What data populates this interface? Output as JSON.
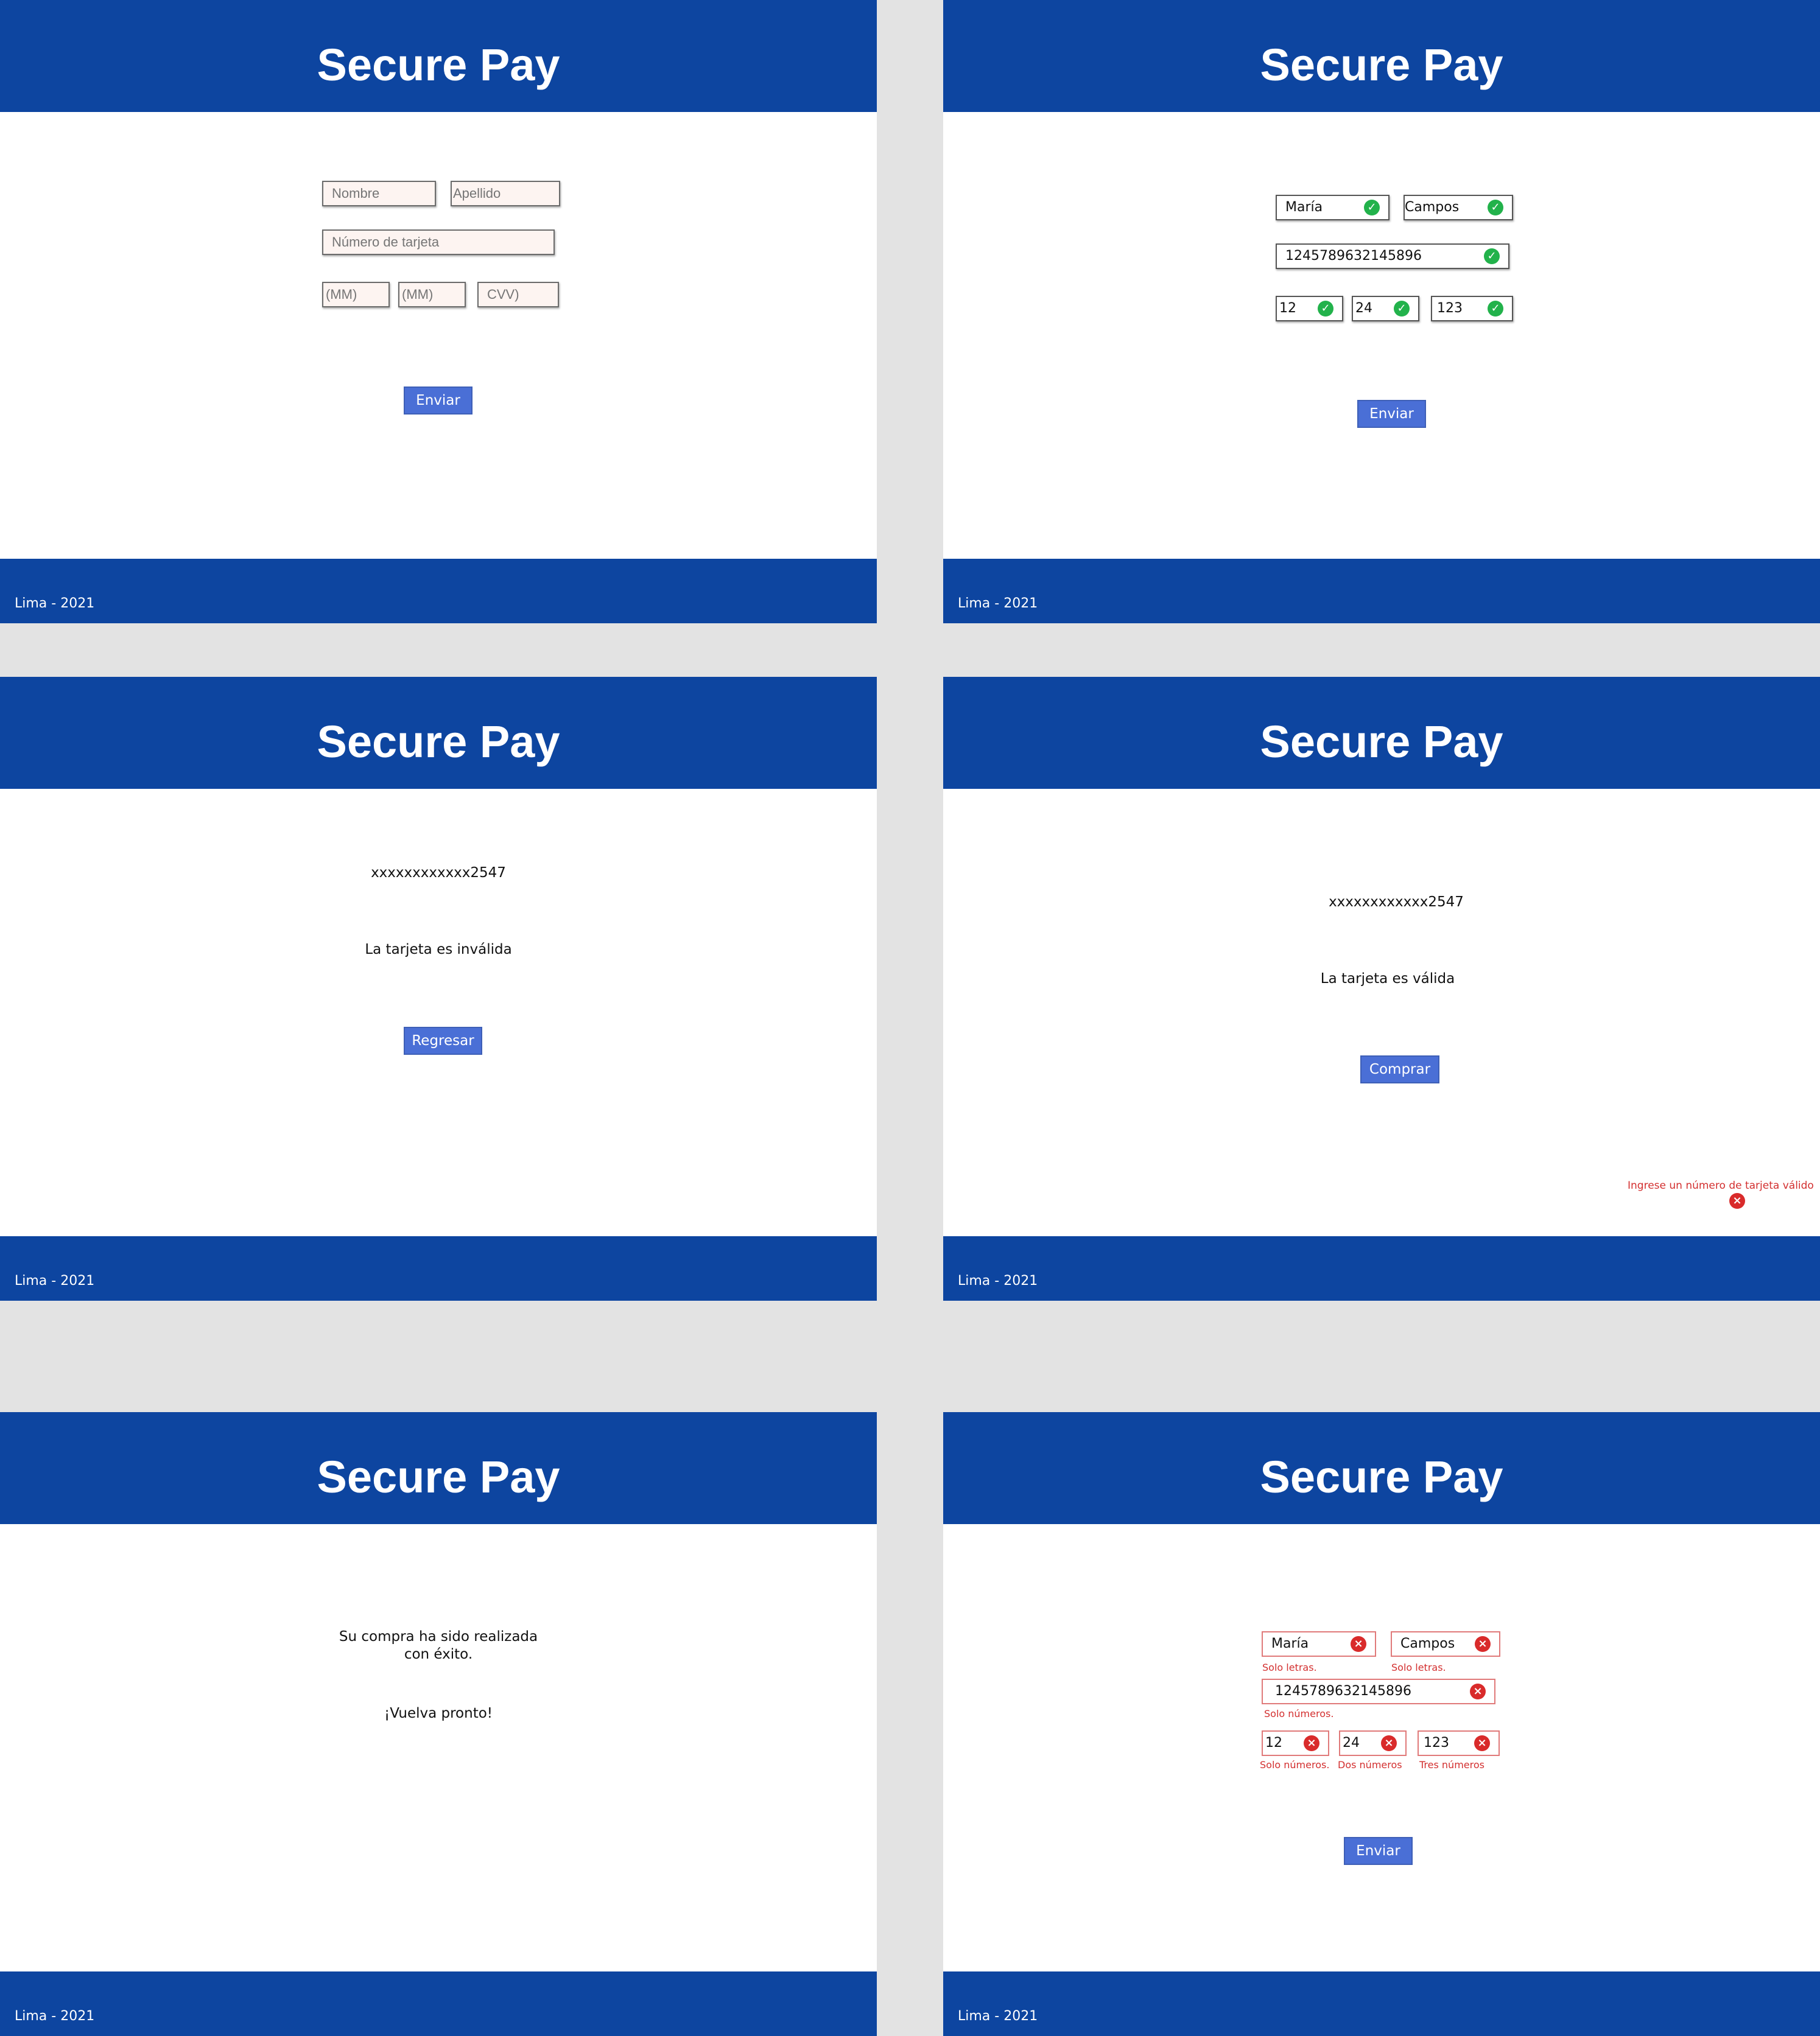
{
  "brand": "Secure Pay",
  "footer": "Lima - 2021",
  "form_empty": {
    "nombre_placeholder": "Nombre",
    "apellido_placeholder": "Apellido",
    "tarjeta_placeholder": "Número de tarjeta",
    "mes_placeholder": "(MM)",
    "anio_placeholder": "(MM)",
    "cvv_placeholder": "CVV)",
    "submit": "Enviar"
  },
  "form_valid": {
    "nombre": "María",
    "apellido": "Campos",
    "tarjeta": "1245789632145896",
    "mes": "12",
    "anio": "24",
    "cvv": "123",
    "submit": "Enviar"
  },
  "invalid_result": {
    "masked_card": "xxxxxxxxxxxx2547",
    "message": "La tarjeta es inválida",
    "button": "Regresar"
  },
  "valid_result": {
    "masked_card": "xxxxxxxxxxxx2547",
    "message": "La tarjeta es válida",
    "button": "Comprar",
    "error_note": "Ingrese un número de tarjeta válido"
  },
  "success": {
    "line1": "Su compra ha sido realizada",
    "line2": "con éxito.",
    "farewell": "¡Vuelva pronto!"
  },
  "form_errors": {
    "nombre": "María",
    "apellido": "Campos",
    "tarjeta": "1245789632145896",
    "mes": "12",
    "anio": "24",
    "cvv": "123",
    "nombre_hint": "Solo letras.",
    "apellido_hint": "Solo letras.",
    "tarjeta_hint": "Solo números.",
    "mes_hint": "Solo números.",
    "anio_hint": "Dos números",
    "cvv_hint": "Tres números",
    "submit": "Enviar"
  }
}
